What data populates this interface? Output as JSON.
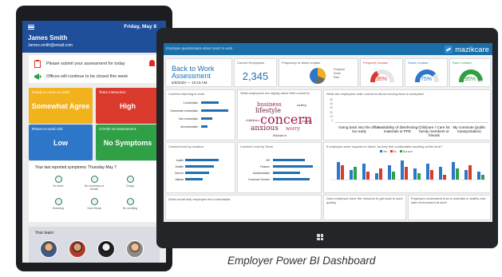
{
  "phone": {
    "header": {
      "date": "Friday, May 8",
      "name": "James Smith",
      "email": "James.smith@email.com"
    },
    "notices": [
      "Please submit your assessment for today",
      "Offices will continue to be closed this week"
    ],
    "tiles": [
      {
        "label": "Ready to return to work:",
        "value": "Somewhat Agree",
        "color": "#f2b21b"
      },
      {
        "label": "Team interaction:",
        "value": "High",
        "color": "#d93a2c"
      },
      {
        "label": "Return-to-work risk:",
        "value": "Low",
        "color": "#2e77c8"
      },
      {
        "label": "COVID-19 assessment:",
        "value": "No Symptoms",
        "color": "#2fa045"
      }
    ],
    "symptoms": {
      "title": "Your last reported symptoms: Thursday May 7",
      "items": [
        "No fever",
        "No shortness of breath",
        "Cough",
        "Sneezing",
        "Sore throat",
        "No vomiting"
      ]
    },
    "team": {
      "title": "Your team:"
    }
  },
  "dashboard": {
    "topbar_text": "Employee questionnaire about return to work",
    "logo_text": "mazikcare",
    "title": "Back to Work Assessment",
    "datetime": "5/8/2020 — 10:15 AM",
    "current_employees_label": "Current Employees",
    "current_employees_value": "2,345",
    "freq_label": "Frequency of direct contact",
    "freq_legend": [
      "Frequent",
      "Some",
      "Rare"
    ],
    "gauges": [
      {
        "label": "Frequent Contact",
        "value": "35%",
        "color": "#d93a2c",
        "fraction": 0.35
      },
      {
        "label": "Some Contact",
        "value": "75%",
        "color": "#2e77c8",
        "fraction": 0.75
      },
      {
        "label": "Rare Contact",
        "value": "95%",
        "color": "#2fa045",
        "fraction": 0.95
      }
    ],
    "comfort_title": "Comfort returning to work",
    "comfort_rows": [
      "Comfortable",
      "Somewhat comfortable",
      "Not comfortable",
      "Uncomfortable"
    ],
    "worry_title": "What employees are saying about their concerns",
    "cloud_words": [
      "business",
      "lifestyle",
      "concern",
      "anxious",
      "worry",
      "safety",
      "children",
      "masks",
      "distance"
    ],
    "concern_title": "What are employees main concerns about coming back to workplace",
    "concern_categories": [
      "Going back into the office too early",
      "Availability of disinfecting materials or PPE",
      "Childcare / Care for family members or friends",
      "My commute (public transportation)"
    ],
    "concern_ticks": [
      "50",
      "40",
      "30",
      "20",
      "10",
      "0"
    ],
    "location_title": "Comfort level by location",
    "location_rows": [
      "Austin",
      "Seattle",
      "Denver",
      "Atlanta"
    ],
    "team_title": "Comfort Level by Team",
    "team_rows": [
      "HR",
      "Finance",
      "Administrative",
      "Customer Service"
    ],
    "travel_title": "If employee were requires to travel, do they feel comfortable traveling at this time?",
    "travel_legend": [
      "Yes",
      "No",
      "Not sure"
    ],
    "bottom_tiles": [
      "What would help employee feel comfortable",
      "Does employee have the resource to get back to work quickly",
      "Employee understand how to maintain a healthy and safe environment at work"
    ]
  },
  "caption": "Employer Power BI Dashboard"
}
